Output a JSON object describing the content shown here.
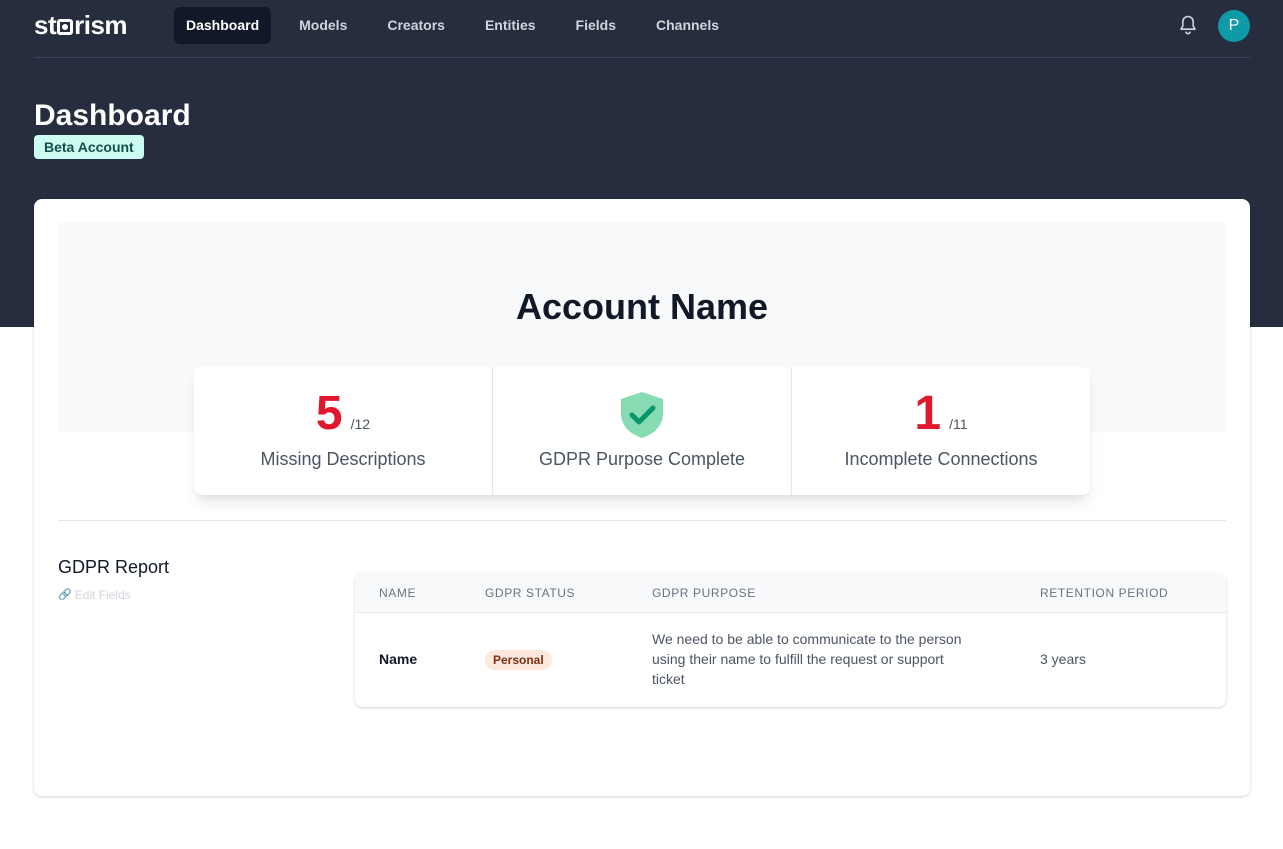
{
  "brand": {
    "logo_pre": "st",
    "logo_post": "rism"
  },
  "nav": {
    "items": [
      {
        "label": "Dashboard",
        "active": true
      },
      {
        "label": "Models",
        "active": false
      },
      {
        "label": "Creators",
        "active": false
      },
      {
        "label": "Entities",
        "active": false
      },
      {
        "label": "Fields",
        "active": false
      },
      {
        "label": "Channels",
        "active": false
      }
    ],
    "notification_icon": "bell-icon",
    "avatar_initial": "P"
  },
  "header": {
    "title": "Dashboard",
    "badge": "Beta Account"
  },
  "account": {
    "name": "Account Name"
  },
  "stats": {
    "missing_descriptions": {
      "value": "5",
      "total": "/12",
      "label": "Missing Descriptions"
    },
    "gdpr": {
      "icon": "shield-check-icon",
      "label": "GDPR Purpose Complete"
    },
    "incomplete_connections": {
      "value": "1",
      "total": "/11",
      "label": "Incomplete Connections"
    }
  },
  "report": {
    "title": "GDPR Report",
    "edit_label": "Edit Fields",
    "columns": [
      "NAME",
      "GDPR STATUS",
      "GDPR PURPOSE",
      "RETENTION PERIOD"
    ],
    "rows": [
      {
        "name": "Name",
        "status": "Personal",
        "purpose_lines": [
          "We need to be able to communicate to the person",
          "using their name to fulfill the request or support",
          "ticket"
        ],
        "retention": "3 years"
      }
    ]
  },
  "colors": {
    "header_bg": "#252d3f",
    "accent_red": "#e0182d",
    "avatar_teal": "#0e9aa7",
    "badge_bg": "#ccfbf1",
    "shield_fill": "#86dbb3",
    "check_green": "#059669",
    "pill_bg": "#fde8dc"
  }
}
